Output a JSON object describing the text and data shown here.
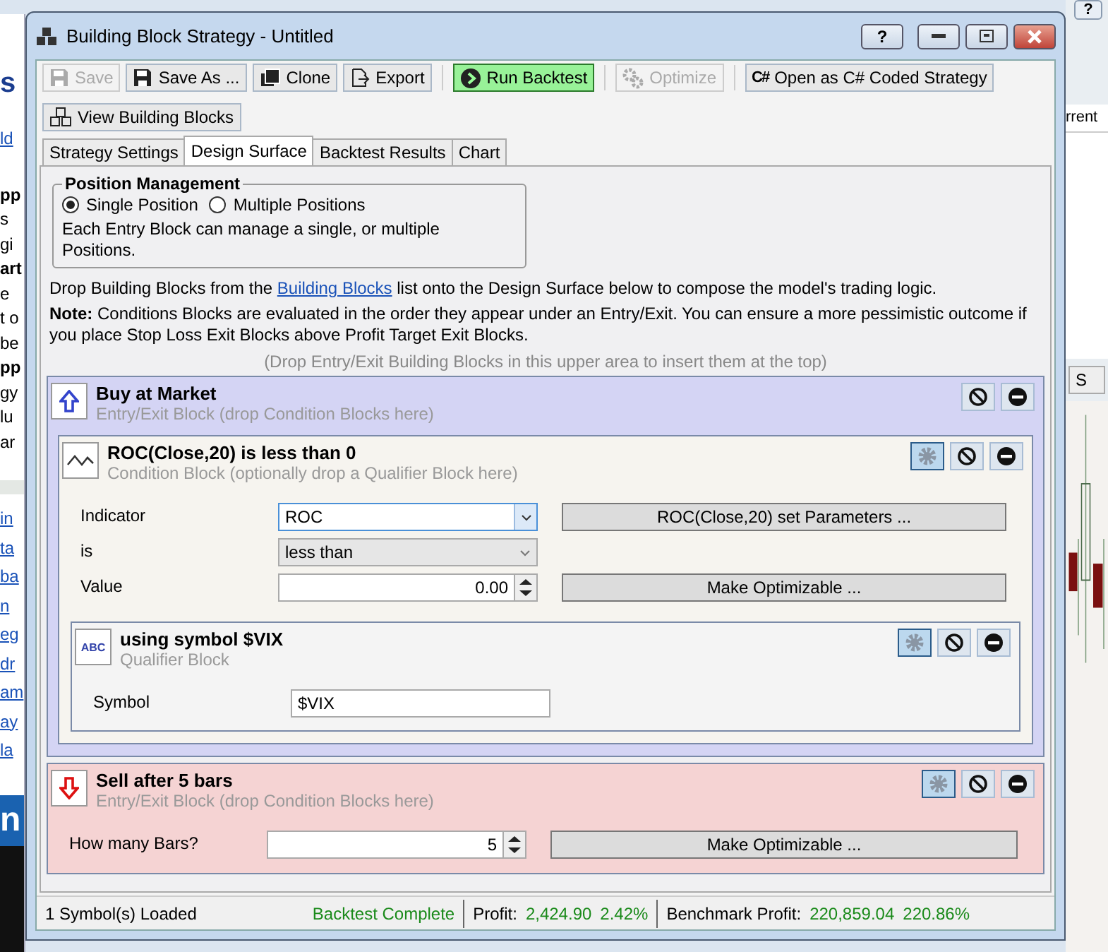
{
  "background": {
    "left_heading": "s",
    "left_link": "ld",
    "left_lines": [
      {
        "text": "pp",
        "bold": true
      },
      {
        "text": "s",
        "bold": false
      },
      {
        "text": "gi",
        "bold": false
      },
      {
        "text": "art",
        "bold": true
      },
      {
        "text": "e",
        "bold": false
      },
      {
        "text": "t o",
        "bold": false
      },
      {
        "text": "be",
        "bold": false
      },
      {
        "text": "pp",
        "bold": true
      },
      {
        "text": "gy",
        "bold": false
      },
      {
        "text": "lu",
        "bold": false
      },
      {
        "text": "ar",
        "bold": false
      }
    ],
    "left_links": [
      "in",
      "ta",
      "ba",
      "n",
      "eg",
      "dr",
      "am",
      "ay",
      "la"
    ],
    "left_banner": "n",
    "right_help": "?",
    "right_header": "rrent",
    "right_button": "S"
  },
  "window": {
    "title": "Building Block Strategy - Untitled",
    "buttons": [
      {
        "kind": "help",
        "label": "?"
      },
      {
        "kind": "minimize"
      },
      {
        "kind": "maximize"
      },
      {
        "kind": "close"
      }
    ]
  },
  "toolbar": [
    {
      "kind": "save",
      "label": "Save",
      "disabled": true
    },
    {
      "kind": "save",
      "label": "Save As ...",
      "disabled": false
    },
    {
      "kind": "clone",
      "label": "Clone",
      "disabled": false
    },
    {
      "kind": "export",
      "label": "Export",
      "disabled": false
    },
    {
      "kind": "separator"
    },
    {
      "kind": "run",
      "label": "Run Backtest",
      "disabled": false
    },
    {
      "kind": "separator"
    },
    {
      "kind": "optimize",
      "label": "Optimize",
      "disabled": true
    },
    {
      "kind": "separator"
    },
    {
      "kind": "code",
      "badge": "C#",
      "label": "Open as C# Coded Strategy",
      "disabled": false
    },
    {
      "kind": "break"
    },
    {
      "kind": "blocks",
      "label": "View Building Blocks",
      "disabled": false
    }
  ],
  "tabs": [
    {
      "label": "Strategy Settings",
      "selected": false
    },
    {
      "label": "Design Surface",
      "selected": true
    },
    {
      "label": "Backtest Results",
      "selected": false
    },
    {
      "label": "Chart",
      "selected": false
    }
  ],
  "position_management": {
    "title": "Position Management",
    "options": [
      {
        "label": "Single Position",
        "selected": true
      },
      {
        "label": "Multiple Positions",
        "selected": false
      }
    ],
    "description": "Each Entry Block can manage a single, or multiple Positions."
  },
  "instructions": {
    "before": "Drop Building Blocks from the ",
    "link": "Building Blocks",
    "after": " list onto the Design Surface below to compose the model's trading logic.",
    "note": "**Note:** Conditions Blocks are evaluated in the order they appear under an Entry/Exit. You can ensure a more pessimistic outcome if you place Stop Loss Exit Blocks above Profit Target Exit Blocks."
  },
  "drop_hint": "(Drop Entry/Exit Building Blocks in this upper area to insert them at the top)",
  "blocks": [
    {
      "kind": "entry",
      "title": "Buy at Market",
      "subtitle": "Entry/Exit Block (drop Condition Blocks here)",
      "has_settings": false,
      "conditions": [
        {
          "title": "ROC(Close,20) is less than 0",
          "subtitle": "Condition Block (optionally drop a Qualifier Block here)",
          "has_settings": true,
          "params": [
            {
              "kind": "dropdown",
              "label": "Indicator",
              "value": "ROC",
              "focused": true,
              "action": "ROC(Close,20) set Parameters ..."
            },
            {
              "kind": "select",
              "label": "is",
              "value": "less than",
              "focused": false
            },
            {
              "kind": "spinner",
              "label": "Value",
              "value": "0.00",
              "focused": false,
              "action": "Make Optimizable ..."
            }
          ],
          "qualifiers": [
            {
              "badge": "ABC",
              "title": "using symbol $VIX",
              "subtitle": "Qualifier Block",
              "has_settings": true,
              "params": [
                {
                  "kind": "text",
                  "label": "Symbol",
                  "value": "$VIX",
                  "focused": false
                }
              ]
            }
          ]
        }
      ]
    },
    {
      "kind": "exit",
      "title": "Sell after 5 bars",
      "subtitle": "Entry/Exit Block (drop Condition Blocks here)",
      "has_settings": true,
      "params": [
        {
          "kind": "spinner",
          "label": "How many Bars?",
          "value": "5",
          "focused": false,
          "action": "Make Optimizable ..."
        }
      ]
    }
  ],
  "status_bar": {
    "symbols": "1 Symbol(s) Loaded",
    "state": "Backtest Complete",
    "profit_label": "Profit:",
    "profit": "2,424.90",
    "profit_pct": "2.42%",
    "benchmark_label": "Benchmark Profit:",
    "benchmark": "220,859.04",
    "benchmark_pct": "220.86%"
  }
}
